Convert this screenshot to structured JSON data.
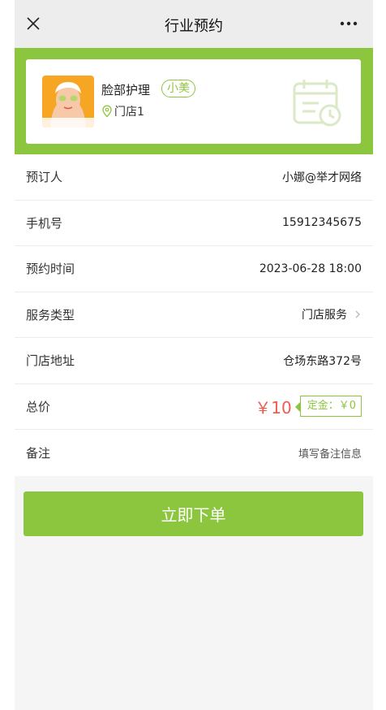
{
  "nav": {
    "title": "行业预约",
    "close_icon": "close-icon",
    "more_icon": "more-dots-icon"
  },
  "service": {
    "name": "脸部护理",
    "tag": "小美",
    "store": "门店1",
    "avatar": "face-mask-avatar",
    "decor_icon": "calendar-icon"
  },
  "rows": {
    "booker": {
      "label": "预订人",
      "value": "小娜@举才网络"
    },
    "phone": {
      "label": "手机号",
      "value": "15912345675"
    },
    "time": {
      "label": "预约时间",
      "value": "2023-06-28 18:00"
    },
    "service_type": {
      "label": "服务类型",
      "value": "门店服务"
    },
    "address": {
      "label": "门店地址",
      "value": "仓场东路372号"
    },
    "total": {
      "label": "总价",
      "price": "￥10",
      "deposit": "定金：￥0"
    },
    "note": {
      "label": "备注",
      "placeholder": "填写备注信息"
    }
  },
  "submit": {
    "label": "立即下单"
  },
  "colors": {
    "brand_green": "#8cc63f",
    "price_red": "#f05a4f",
    "navbar_bg": "#ededed"
  }
}
